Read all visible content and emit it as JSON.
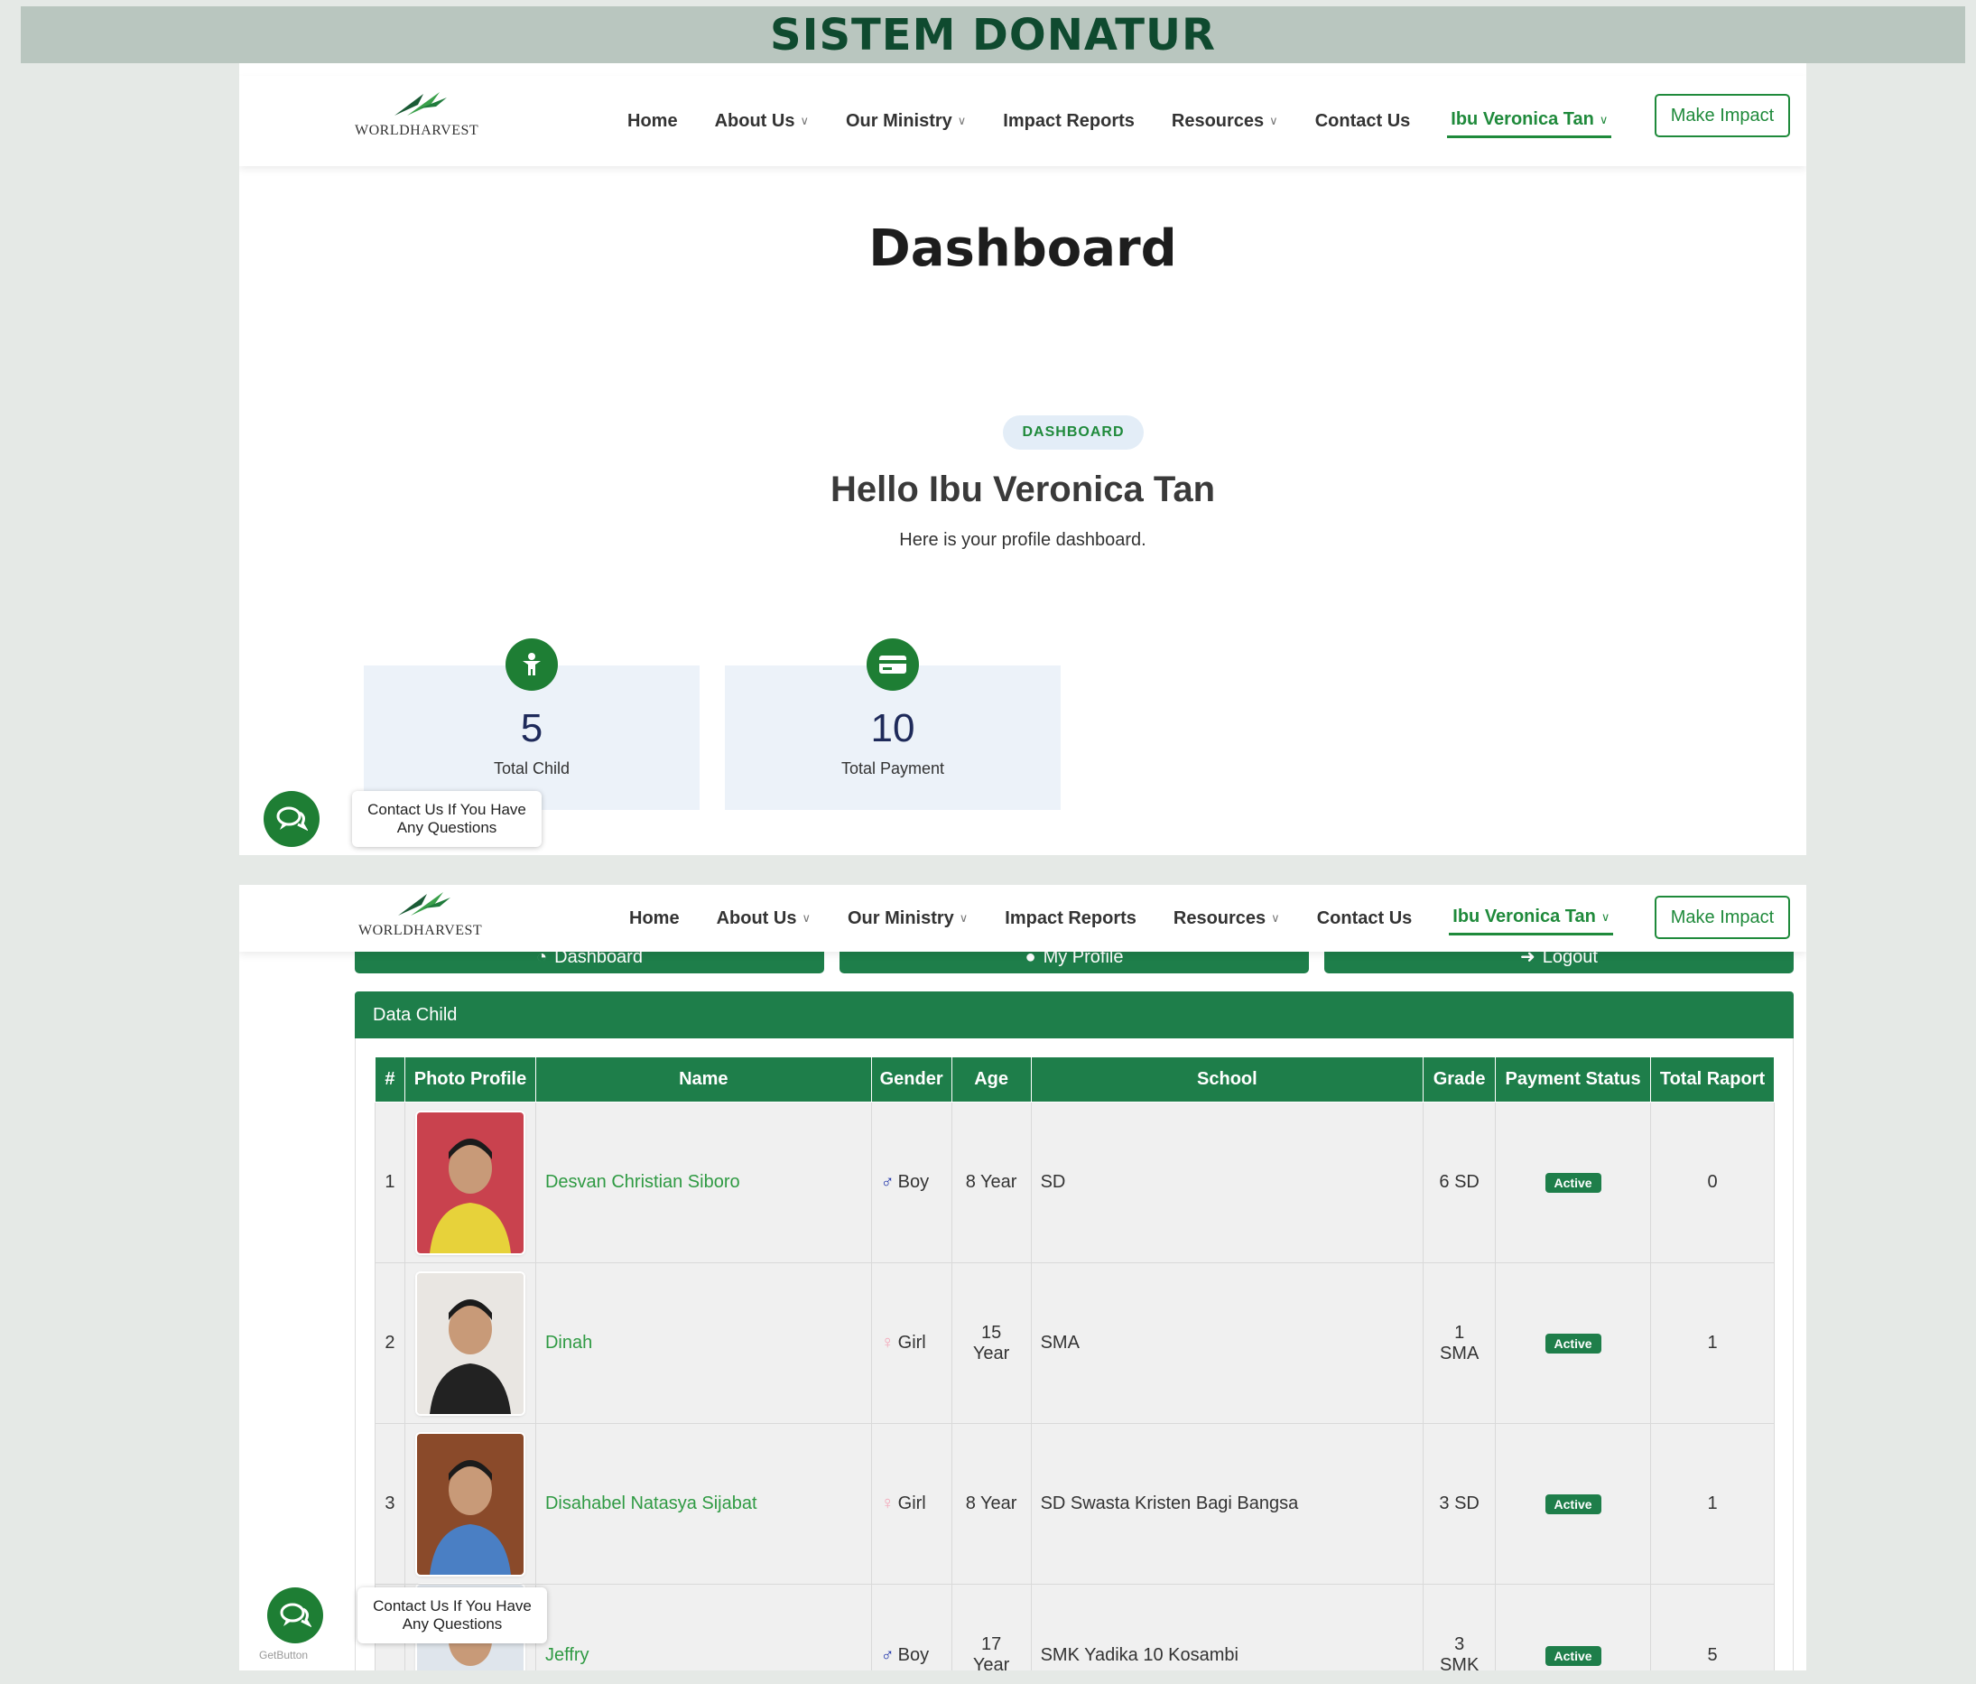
{
  "banner": {
    "title": "SISTEM DONATUR"
  },
  "brand": {
    "logo_text": "WORLDHARVEST"
  },
  "nav": {
    "items": [
      {
        "label": "Home",
        "dropdown": false
      },
      {
        "label": "About Us",
        "dropdown": true
      },
      {
        "label": "Our Ministry",
        "dropdown": true
      },
      {
        "label": "Impact Reports",
        "dropdown": false
      },
      {
        "label": "Resources",
        "dropdown": true
      },
      {
        "label": "Contact Us",
        "dropdown": false
      },
      {
        "label": "Ibu Veronica Tan",
        "dropdown": true,
        "active": true
      }
    ],
    "cta": "Make Impact"
  },
  "dashboard": {
    "title": "Dashboard",
    "badge": "DASHBOARD",
    "greeting": "Hello Ibu Veronica Tan",
    "subtitle": "Here is your profile dashboard.",
    "stats": [
      {
        "value": "5",
        "label": "Total Child",
        "icon": "child-icon"
      },
      {
        "value": "10",
        "label": "Total Payment",
        "icon": "credit-card-icon"
      }
    ]
  },
  "chat": {
    "tooltip": "Contact Us If You Have Any Questions",
    "brand": "GetButton"
  },
  "actions": [
    {
      "label": "Dashboard",
      "icon": "dashboard-icon"
    },
    {
      "label": "My Profile",
      "icon": "user-icon"
    },
    {
      "label": "Logout",
      "icon": "logout-icon"
    }
  ],
  "data_child": {
    "title": "Data Child",
    "columns": [
      "#",
      "Photo Profile",
      "Name",
      "Gender",
      "Age",
      "School",
      "Grade",
      "Payment Status",
      "Total Raport"
    ],
    "rows": [
      {
        "no": "1",
        "name": "Desvan Christian Siboro",
        "gender": "Boy",
        "age": "8 Year",
        "school": "SD",
        "grade": "6 SD",
        "status": "Active",
        "raport": "0",
        "photo_bg": "#c9424e",
        "shirt": "#e7d23a"
      },
      {
        "no": "2",
        "name": "Dinah",
        "gender": "Girl",
        "age": "15 Year",
        "school": "SMA",
        "grade": "1 SMA",
        "status": "Active",
        "raport": "1",
        "photo_bg": "#e9e6e2",
        "shirt": "#222222"
      },
      {
        "no": "3",
        "name": "Disahabel Natasya Sijabat",
        "gender": "Girl",
        "age": "8 Year",
        "school": "SD Swasta Kristen Bagi Bangsa",
        "grade": "3 SD",
        "status": "Active",
        "raport": "1",
        "photo_bg": "#8a4a2a",
        "shirt": "#4a7fc4"
      },
      {
        "no": "",
        "name": "Jeffry",
        "gender": "Boy",
        "age": "17 Year",
        "school": "SMK Yadika 10 Kosambi",
        "grade": "3 SMK",
        "status": "Active",
        "raport": "5",
        "photo_bg": "#dfe5ec",
        "shirt": "#2a3f9a"
      }
    ]
  },
  "colors": {
    "brand_green": "#1e7e4a",
    "link_green": "#2f9a43",
    "banner_bg": "#b9c6bf"
  }
}
